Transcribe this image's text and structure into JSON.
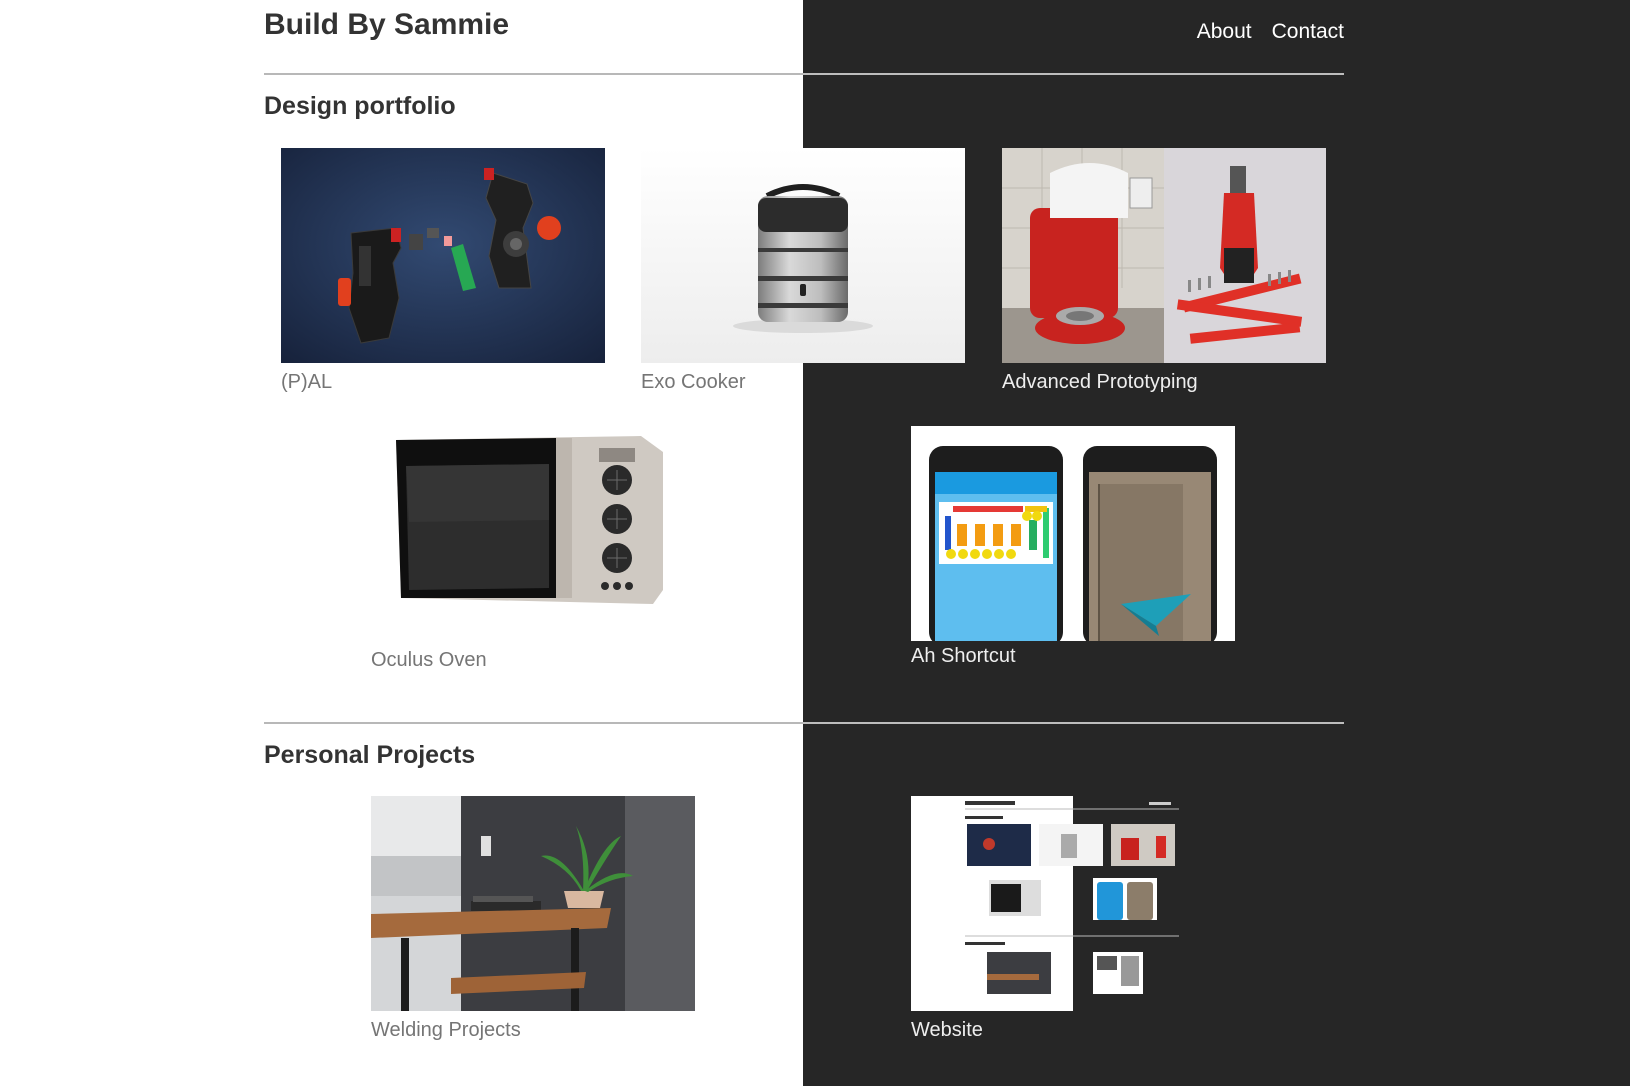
{
  "header": {
    "title": "Build By Sammie",
    "nav": [
      {
        "label": "About"
      },
      {
        "label": "Contact"
      }
    ]
  },
  "sections": [
    {
      "title": "Design portfolio",
      "items": [
        {
          "caption": "(P)AL"
        },
        {
          "caption": "Exo Cooker"
        },
        {
          "caption": "Advanced Prototyping"
        },
        {
          "caption": "Oculus Oven"
        },
        {
          "caption": "Ah Shortcut"
        }
      ]
    },
    {
      "title": "Personal Projects",
      "items": [
        {
          "caption": "Welding Projects"
        },
        {
          "caption": "Website"
        }
      ]
    }
  ],
  "colors": {
    "dark_background": "#262626",
    "light_background": "#ffffff",
    "heading": "#333333",
    "caption_light": "#757575",
    "caption_dark": "#eeeeee"
  }
}
